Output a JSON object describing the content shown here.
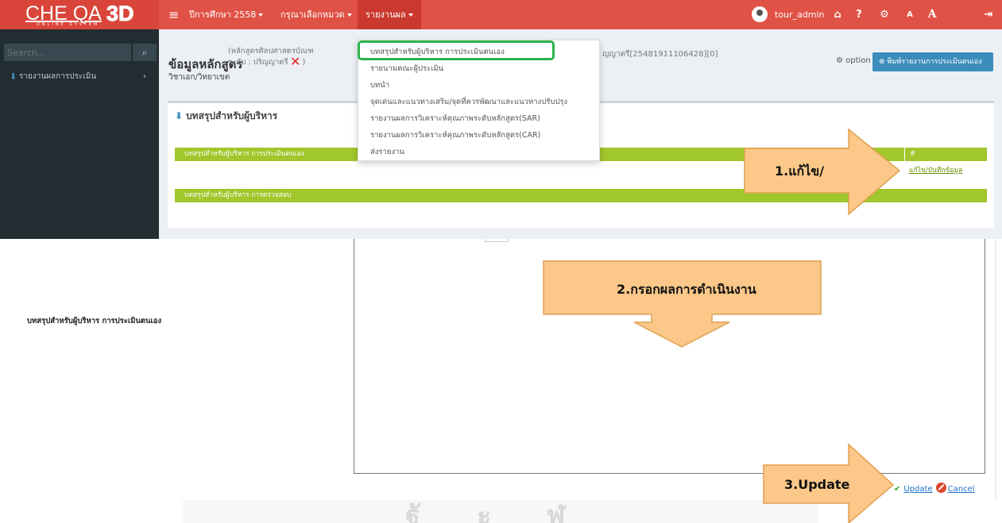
{
  "topbar": {
    "logo_main": "CHE QA",
    "logo_3d": "3D",
    "logo_sub": "ONLINE SYSTEM",
    "menu_icon": "≡",
    "year_label": "ปีการศึกษา 2558",
    "category_label": "กรุณาเลือกหมวด",
    "report_label": "รายงานผล",
    "user_name": "tour_admin",
    "icons": [
      "user-avatar-icon",
      "home-icon",
      "help-icon",
      "settings-icon",
      "font-small-icon",
      "font-large-icon",
      "logout-icon"
    ],
    "icon_glyphs": {
      "home": "⌂",
      "help": "?",
      "settings": "⚙",
      "font_small": "A",
      "font_large": "A",
      "logout": "⇥"
    },
    "accent_color": "#e05245"
  },
  "sidebar": {
    "search_placeholder": "Search...",
    "item_label": "รายงานผลการประเมิน"
  },
  "header": {
    "title": "ข้อมูลหลักสูตร",
    "sub_line1": "(หลักสูตรศิลปศาสตรบัณฑ",
    "sub_line2": "ระดับ : ปริญญาตรี",
    "close_symbol": "✕",
    "sub_close": ")",
    "major": "วิชาเอก/วิทยาเขต",
    "course_code": "ญญาตรี[25481911106428][0]",
    "option_label": "option",
    "option_sep": ">",
    "print_button": "พิมพ์รายงานการประเมินตนเอง"
  },
  "dropdown": {
    "items": [
      "บทสรุปสำหรับผู้บริหาร การประเมินตนเอง",
      "รายนามคณะผู้ประเมิน",
      "บทนำ",
      "จุดเด่นและแนวทางเสริม/จุดที่ควรพัฒนาและแนวทางปรับปรุง",
      "รายงานผลการวิเคราะห์คุณภาพระดับหลักสูตร(SAR)",
      "รายงานผลการวิเคราะห์คุณภาพระดับหลักสูตร(CAR)",
      "ส่งรายงาน"
    ],
    "highlight_color": "#2bb34b"
  },
  "box": {
    "title": "บทสรุปสำหรับผู้บริหาร",
    "bar1_label": "บทสรุปสำหรับผู้บริหาร การประเมินตนเอง",
    "bar1_hash": "#",
    "edit_link": "แก้ไข/บันทึกข้อมูล",
    "bar2_label": "บทสรุปสำหรับผู้บริหาร การตรวจสอบ",
    "bar_color": "#a0c72c"
  },
  "lower": {
    "field_label": "บทสรุปสำหรับผู้บริหาร การประเมินตนเอง",
    "update_label": "Update",
    "cancel_label": "Cancel",
    "check_glyph": "✔"
  },
  "callouts": {
    "step1": "1.แก้ไข/",
    "step2": "2.กรอกผลการดำเนินงาน",
    "step3": "3.Update",
    "fill_color": "#fbc889",
    "stroke_color": "#e0a050"
  },
  "watermark": {
    "glyphs": [
      "ฐั",
      "ะ",
      "ฬู"
    ]
  }
}
